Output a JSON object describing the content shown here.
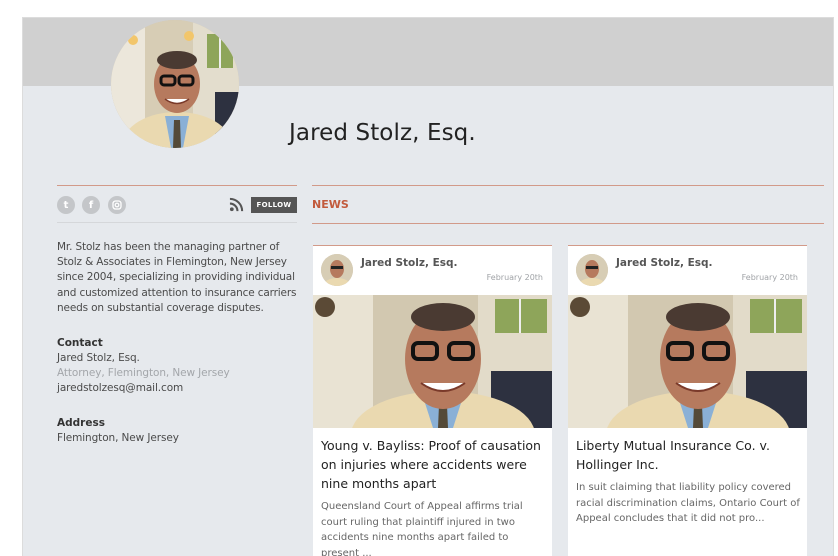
{
  "profile": {
    "name": "Jared Stolz, Esq.",
    "bio": "Mr. Stolz has been the managing partner of Stolz & Associates in Flemington, New Jersey since 2004, specializing in providing individual and customized attention to insurance carriers needs on substantial coverage disputes."
  },
  "social": {
    "twitter_icon": "twitter-icon",
    "facebook_icon": "facebook-icon",
    "instagram_icon": "instagram-icon",
    "rss_icon": "rss-icon",
    "follow_label": "FOLLOW"
  },
  "contact": {
    "heading": "Contact",
    "name": "Jared Stolz, Esq.",
    "title_line": "Attorney, Flemington, New Jersey",
    "email": "jaredstolzesq@mail.com"
  },
  "address": {
    "heading": "Address",
    "value": "Flemington, New Jersey"
  },
  "news": {
    "label": "NEWS",
    "cards": [
      {
        "author": "Jared Stolz, Esq.",
        "date": "February 20th",
        "title": "Young v. Bayliss: Proof of causation on injuries where accidents were nine months apart",
        "excerpt": "Queensland Court of Appeal affirms trial court ruling that plaintiff injured in two accidents nine months apart failed to present ..."
      },
      {
        "author": "Jared Stolz, Esq.",
        "date": "February 20th",
        "title": "Liberty Mutual Insurance Co. v. Hollinger Inc.",
        "excerpt": "In suit claiming that liability policy covered racial discrimination claims, Ontario Court of Appeal concludes that it did not pro..."
      }
    ]
  },
  "colors": {
    "accent": "#c25a3c",
    "rule": "#d29a89",
    "background": "#e6e9ed",
    "banner": "#d0d0d0"
  }
}
